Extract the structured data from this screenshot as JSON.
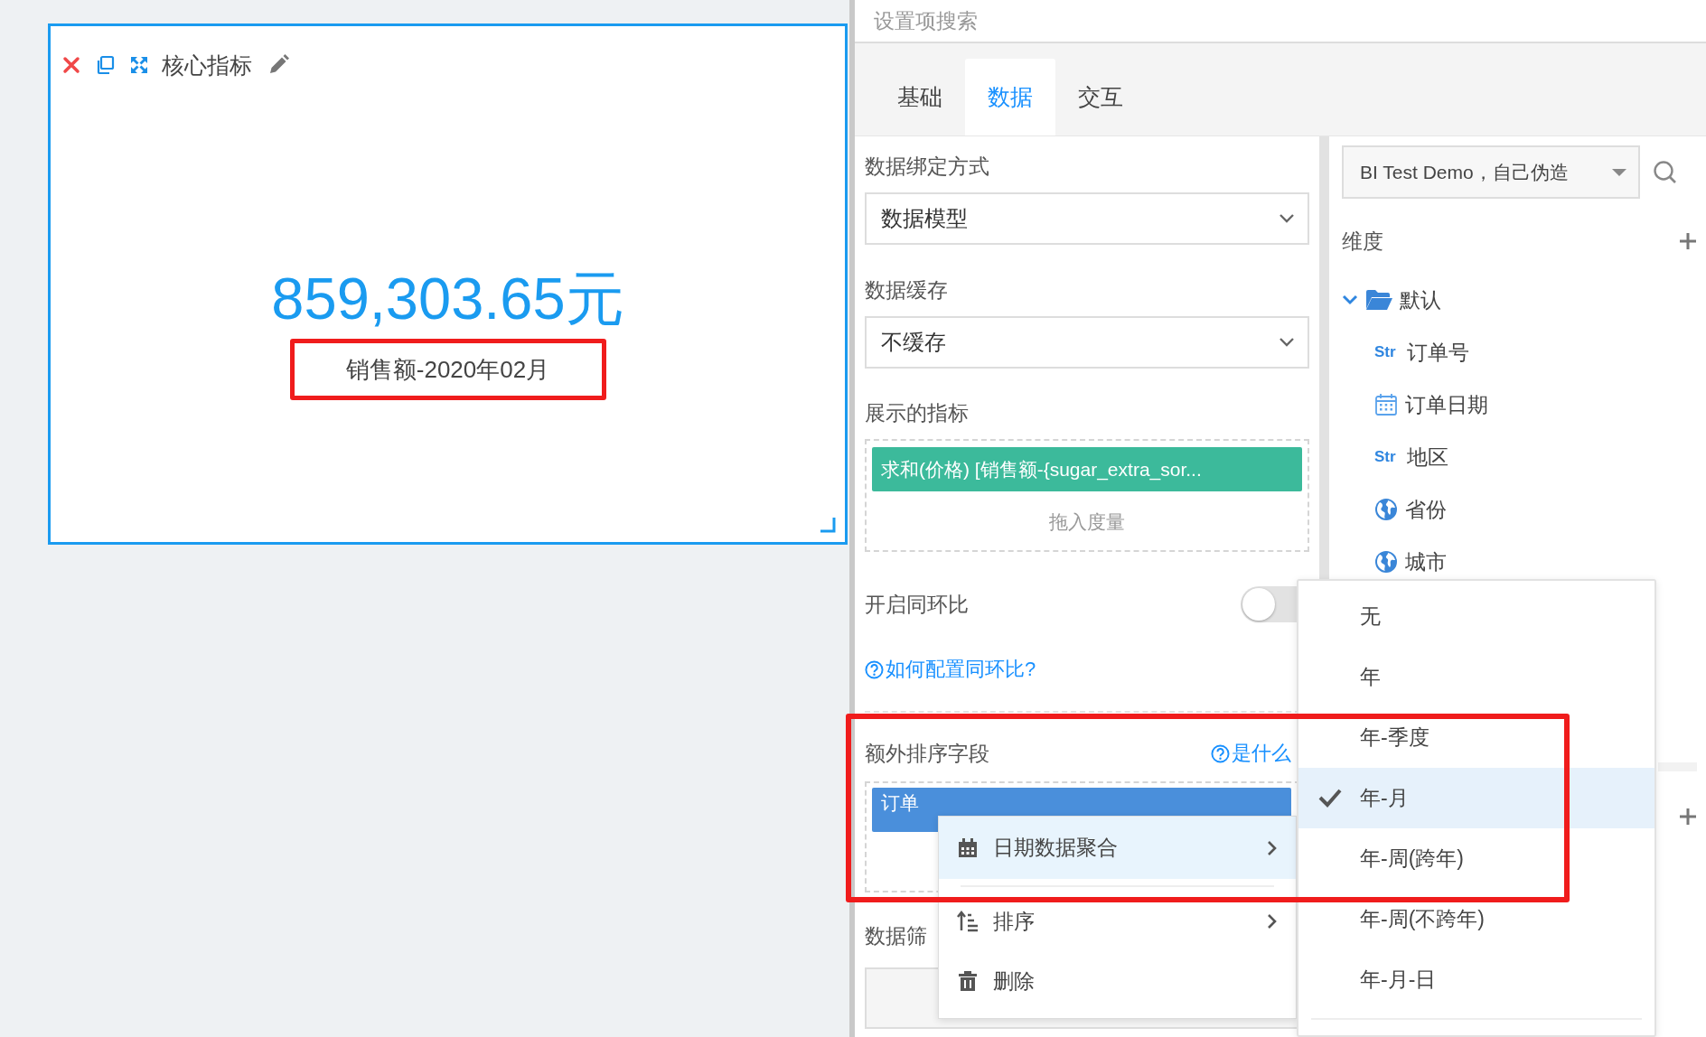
{
  "card": {
    "title": "核心指标",
    "value": "859,303.65元",
    "subtitle": {
      "text": "销售额-2020年02月",
      "highlighted": true
    }
  },
  "settings": {
    "search": {
      "placeholder": "设置项搜索"
    },
    "tabs": [
      {
        "label": "基础",
        "selected": false
      },
      {
        "label": "数据",
        "selected": true
      },
      {
        "label": "交互",
        "selected": false
      }
    ],
    "binding": {
      "label": "数据绑定方式",
      "value": "数据模型"
    },
    "cache": {
      "label": "数据缓存",
      "value": "不缓存"
    },
    "metrics": {
      "label": "展示的指标",
      "items": [
        "求和(价格) [销售额-{sugar_extra_sor..."
      ],
      "drop_hint": "拖入度量"
    },
    "compare": {
      "label": "开启同环比",
      "on": false,
      "help_link": "如何配置同环比?"
    },
    "extra_sort": {
      "label": "额外排序字段",
      "help_link": "是什么",
      "fields": [
        "订单"
      ],
      "highlighted": true
    },
    "filter": {
      "label": "数据筛"
    }
  },
  "fields": {
    "dataset": "BI Test Demo，自己伪造",
    "dimensions": {
      "label": "维度",
      "tree": [
        {
          "label": "默认",
          "expanded": true,
          "children": [
            {
              "kind": "str",
              "type_label": "Str",
              "label": "订单号"
            },
            {
              "kind": "date",
              "label": "订单日期"
            },
            {
              "kind": "str",
              "type_label": "Str",
              "label": "地区"
            },
            {
              "kind": "geo",
              "label": "省份"
            },
            {
              "kind": "geo",
              "label": "城市"
            }
          ]
        }
      ]
    }
  },
  "context_menu": {
    "items": [
      {
        "kind": "date",
        "label": "日期数据聚合",
        "selected": true,
        "submenu": true
      },
      {
        "kind": "sort",
        "label": "排序",
        "selected": false,
        "submenu": true
      },
      {
        "kind": "delete",
        "label": "删除",
        "selected": false,
        "submenu": false
      }
    ]
  },
  "aggregation_menu": {
    "items": [
      {
        "label": "无",
        "selected": false
      },
      {
        "label": "年",
        "selected": false
      },
      {
        "label": "年-季度",
        "selected": false
      },
      {
        "label": "年-月",
        "selected": true
      },
      {
        "label": "年-周(跨年)",
        "selected": false
      },
      {
        "label": "年-周(不跨年)",
        "selected": false
      },
      {
        "label": "年-月-日",
        "selected": false
      }
    ]
  }
}
